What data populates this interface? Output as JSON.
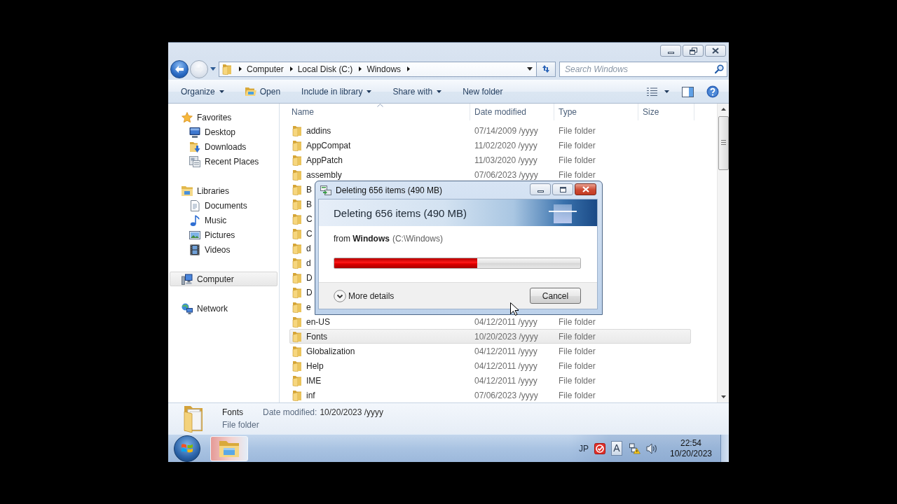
{
  "window": {
    "nav_buttons": [
      {
        "kind": "back",
        "disabled": false
      },
      {
        "kind": "forward",
        "disabled": true
      }
    ],
    "address": {
      "crumbs": [
        "Computer",
        "Local Disk (C:)",
        "Windows"
      ]
    },
    "search": {
      "placeholder": "Search Windows"
    }
  },
  "toolbar": {
    "items": [
      {
        "kind": "menu",
        "label": "Organize"
      },
      {
        "kind": "open",
        "label": "Open"
      },
      {
        "kind": "menu",
        "label": "Include in library"
      },
      {
        "kind": "menu",
        "label": "Share with"
      },
      {
        "kind": "plain",
        "label": "New folder"
      }
    ]
  },
  "nav_pane": {
    "groups": [
      {
        "kind": "favorites",
        "label": "Favorites",
        "selected": false,
        "children": [
          {
            "kind": "desktop",
            "label": "Desktop",
            "selected": false
          },
          {
            "kind": "downloads",
            "label": "Downloads",
            "selected": false
          },
          {
            "kind": "recent",
            "label": "Recent Places",
            "selected": false
          }
        ]
      },
      {
        "kind": "libraries",
        "label": "Libraries",
        "selected": false,
        "children": [
          {
            "kind": "documents",
            "label": "Documents",
            "selected": false
          },
          {
            "kind": "music",
            "label": "Music",
            "selected": false
          },
          {
            "kind": "pictures",
            "label": "Pictures",
            "selected": false
          },
          {
            "kind": "videos",
            "label": "Videos",
            "selected": false
          }
        ]
      },
      {
        "kind": "computer",
        "label": "Computer",
        "selected": true
      },
      {
        "kind": "network",
        "label": "Network",
        "selected": false
      }
    ]
  },
  "file_list": {
    "columns": [
      {
        "label": "Name",
        "sorted": true
      },
      {
        "label": "Date modified",
        "sorted": false
      },
      {
        "label": "Type",
        "sorted": false
      },
      {
        "label": "Size",
        "sorted": false
      }
    ],
    "rows": [
      {
        "name": "addins",
        "date": "07/14/2009 /yyyy",
        "type": "File folder",
        "selected": false
      },
      {
        "name": "AppCompat",
        "date": "11/02/2020 /yyyy",
        "type": "File folder",
        "selected": false
      },
      {
        "name": "AppPatch",
        "date": "11/03/2020 /yyyy",
        "type": "File folder",
        "selected": false
      },
      {
        "name": "assembly",
        "date": "07/06/2023 /yyyy",
        "type": "File folder",
        "selected": false
      },
      {
        "name": "B",
        "selected": false
      },
      {
        "name": "B",
        "selected": false
      },
      {
        "name": "C",
        "selected": false
      },
      {
        "name": "C",
        "selected": false
      },
      {
        "name": "d",
        "selected": false
      },
      {
        "name": "d",
        "selected": false
      },
      {
        "name": "D",
        "selected": false
      },
      {
        "name": "D",
        "selected": false
      },
      {
        "name": "e",
        "selected": false
      },
      {
        "name": "en-US",
        "date": "04/12/2011 /yyyy",
        "type": "File folder",
        "selected": false
      },
      {
        "name": "Fonts",
        "date": "10/20/2023 /yyyy",
        "type": "File folder",
        "selected": true
      },
      {
        "name": "Globalization",
        "date": "04/12/2011 /yyyy",
        "type": "File folder",
        "selected": false
      },
      {
        "name": "Help",
        "date": "04/12/2011 /yyyy",
        "type": "File folder",
        "selected": false
      },
      {
        "name": "IME",
        "date": "04/12/2011 /yyyy",
        "type": "File folder",
        "selected": false
      },
      {
        "name": "inf",
        "date": "07/06/2023 /yyyy",
        "type": "File folder",
        "selected": false
      }
    ]
  },
  "dialog": {
    "title": "Deleting 656 items (490 MB)",
    "heading": "Deleting 656 items (490 MB)",
    "source": "from **Windows**",
    "source_path": "(C:\\Windows)",
    "progress": {
      "level": 0.58,
      "error": true
    },
    "details_button": "More details",
    "cancel_button": "Cancel"
  },
  "details_pane": {
    "name": "Fonts",
    "date_label": "Date modified:",
    "date": "10/20/2023 /yyyy",
    "type": "File folder"
  },
  "taskbar": {
    "buttons": [
      {
        "kind": "explorer",
        "selected": true
      }
    ],
    "tray": {
      "language": "JP",
      "ime_mode": "A",
      "time": "22:54",
      "date": "10/20/2023"
    }
  }
}
